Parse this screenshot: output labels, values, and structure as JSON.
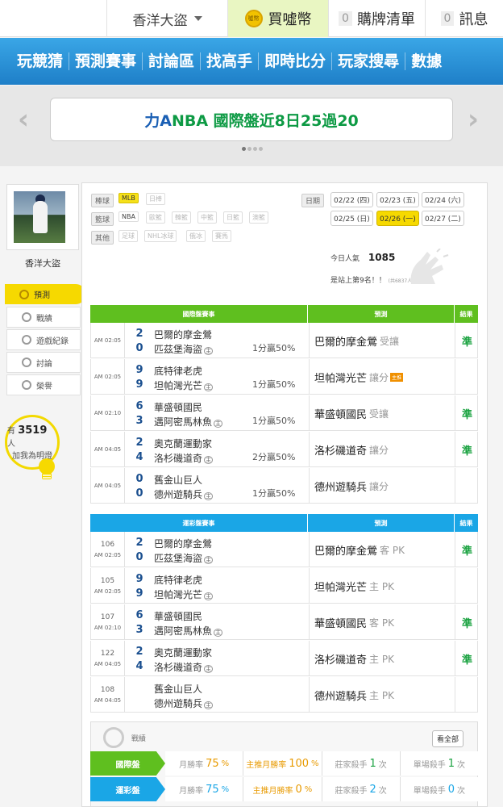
{
  "topbar": {
    "username": "香洋大盜",
    "buy_label": "買噓幣",
    "coin_icon_text": "噓幣",
    "cart_count": "0",
    "cart_label": "購牌清單",
    "msg_count": "0",
    "msg_label": "訊息"
  },
  "nav": [
    "玩競猜",
    "預測賽事",
    "討論區",
    "找高手",
    "即時比分",
    "玩家搜尋",
    "數據"
  ],
  "banner": {
    "prefix": "力A",
    "text": " NBA 國際盤近8日25過20"
  },
  "sidebar": {
    "name": "香洋大盜",
    "menu": [
      "預測",
      "戰績",
      "遊戲紀錄",
      "討論",
      "榮譽"
    ],
    "fans_prefix": "有",
    "fans_count": "3519",
    "fans_suffix": "人",
    "fans_note": "加我為明燈"
  },
  "filters": {
    "baseball_label": "棒球",
    "baseball": [
      "MLB",
      "日棒"
    ],
    "basketball_label": "籃球",
    "basketball": [
      "NBA",
      "歐籃",
      "韓籃",
      "中籃",
      "日籃",
      "澳籃"
    ],
    "other_label": "其他",
    "other": [
      "足球",
      "NHL冰球",
      "俄冰",
      "賽馬"
    ]
  },
  "dates": {
    "label": "日期",
    "row1": [
      "02/22 (四)",
      "02/23 (五)",
      "02/24 (六)"
    ],
    "row2": [
      "02/25 (日)",
      "02/26 (一)",
      "02/27 (二)"
    ]
  },
  "popularity": {
    "label": "今日人氣",
    "value": "1085",
    "rank": "是站上第9名！！",
    "rank_small": "(共6837人)"
  },
  "intl_table": {
    "headers": [
      "國際盤賽事",
      "預測",
      "結果"
    ],
    "rows": [
      {
        "time": "AM 02:05",
        "s1": "2",
        "s2": "0",
        "t1": "巴爾的摩金鶯",
        "t2": "匹茲堡海盜",
        "home": "主",
        "odds": "1分贏50%",
        "pred": "巴爾的摩金鶯",
        "pred_sub": "受讓",
        "hot": "",
        "result": "準"
      },
      {
        "time": "AM 02:05",
        "s1": "9",
        "s2": "9",
        "t1": "底特律老虎",
        "t2": "坦帕灣光芒",
        "home": "主",
        "odds": "1分贏50%",
        "pred": "坦帕灣光芒",
        "pred_sub": "讓分",
        "hot": "主推",
        "result": ""
      },
      {
        "time": "AM 02:10",
        "s1": "6",
        "s2": "3",
        "t1": "華盛頓國民",
        "t2": "邁阿密馬林魚",
        "home": "主",
        "odds": "1分贏50%",
        "pred": "華盛頓國民",
        "pred_sub": "受讓",
        "hot": "",
        "result": "準"
      },
      {
        "time": "AM 04:05",
        "s1": "2",
        "s2": "4",
        "t1": "奧克蘭運動家",
        "t2": "洛杉磯道奇",
        "home": "主",
        "odds": "2分贏50%",
        "pred": "洛杉磯道奇",
        "pred_sub": "讓分",
        "hot": "",
        "result": "準"
      },
      {
        "time": "AM 04:05",
        "s1": "0",
        "s2": "0",
        "t1": "舊金山巨人",
        "t2": "德州遊騎兵",
        "home": "主",
        "odds": "1分贏50%",
        "pred": "德州遊騎兵",
        "pred_sub": "讓分",
        "hot": "",
        "result": ""
      }
    ]
  },
  "sport_table": {
    "headers": [
      "運彩盤賽事",
      "預測",
      "結果"
    ],
    "rows": [
      {
        "no": "106",
        "time": "AM 02:05",
        "s1": "2",
        "s2": "0",
        "t1": "巴爾的摩金鶯",
        "t2": "匹茲堡海盜",
        "home": "主",
        "pred": "巴爾的摩金鶯",
        "pred_sub": "客 PK",
        "result": "準"
      },
      {
        "no": "105",
        "time": "AM 02:05",
        "s1": "9",
        "s2": "9",
        "t1": "底特律老虎",
        "t2": "坦帕灣光芒",
        "home": "主",
        "pred": "坦帕灣光芒",
        "pred_sub": "主 PK",
        "result": ""
      },
      {
        "no": "107",
        "time": "AM 02:10",
        "s1": "6",
        "s2": "3",
        "t1": "華盛頓國民",
        "t2": "邁阿密馬林魚",
        "home": "主",
        "pred": "華盛頓國民",
        "pred_sub": "客 PK",
        "result": "準"
      },
      {
        "no": "122",
        "time": "AM 04:05",
        "s1": "2",
        "s2": "4",
        "t1": "奧克蘭運動家",
        "t2": "洛杉磯道奇",
        "home": "主",
        "pred": "洛杉磯道奇",
        "pred_sub": "主 PK",
        "result": "準"
      },
      {
        "no": "108",
        "time": "AM 04:05",
        "s1": "",
        "s2": "",
        "t1": "舊金山巨人",
        "t2": "德州遊騎兵",
        "home": "主",
        "pred": "德州遊騎兵",
        "pred_sub": "主 PK",
        "result": ""
      }
    ]
  },
  "summary": {
    "title": "戰績",
    "view_all": "看全部",
    "rows": [
      {
        "label": "國際盤",
        "c1_l": "月勝率",
        "c1_v": "75",
        "c1_u": "%",
        "c2_l": "主推月勝率",
        "c2_v": "100",
        "c2_u": "%",
        "c3_l": "莊家殺手",
        "c3_v": "1",
        "c3_u": "次",
        "c4_l": "單場殺手",
        "c4_v": "1",
        "c4_u": "次"
      },
      {
        "label": "運彩盤",
        "c1_l": "月勝率",
        "c1_v": "75",
        "c1_u": "%",
        "c2_l": "主推月勝率",
        "c2_v": "0",
        "c2_u": "%",
        "c3_l": "莊家殺手",
        "c3_v": "2",
        "c3_u": "次",
        "c4_l": "單場殺手",
        "c4_v": "0",
        "c4_u": "次"
      }
    ]
  },
  "colors": {
    "nav": "#1e7fc8",
    "intl_green": "#5fbf1f",
    "sport_blue": "#1aa6e6",
    "accent_yellow": "#f6d900",
    "win_green": "#1aa240"
  }
}
